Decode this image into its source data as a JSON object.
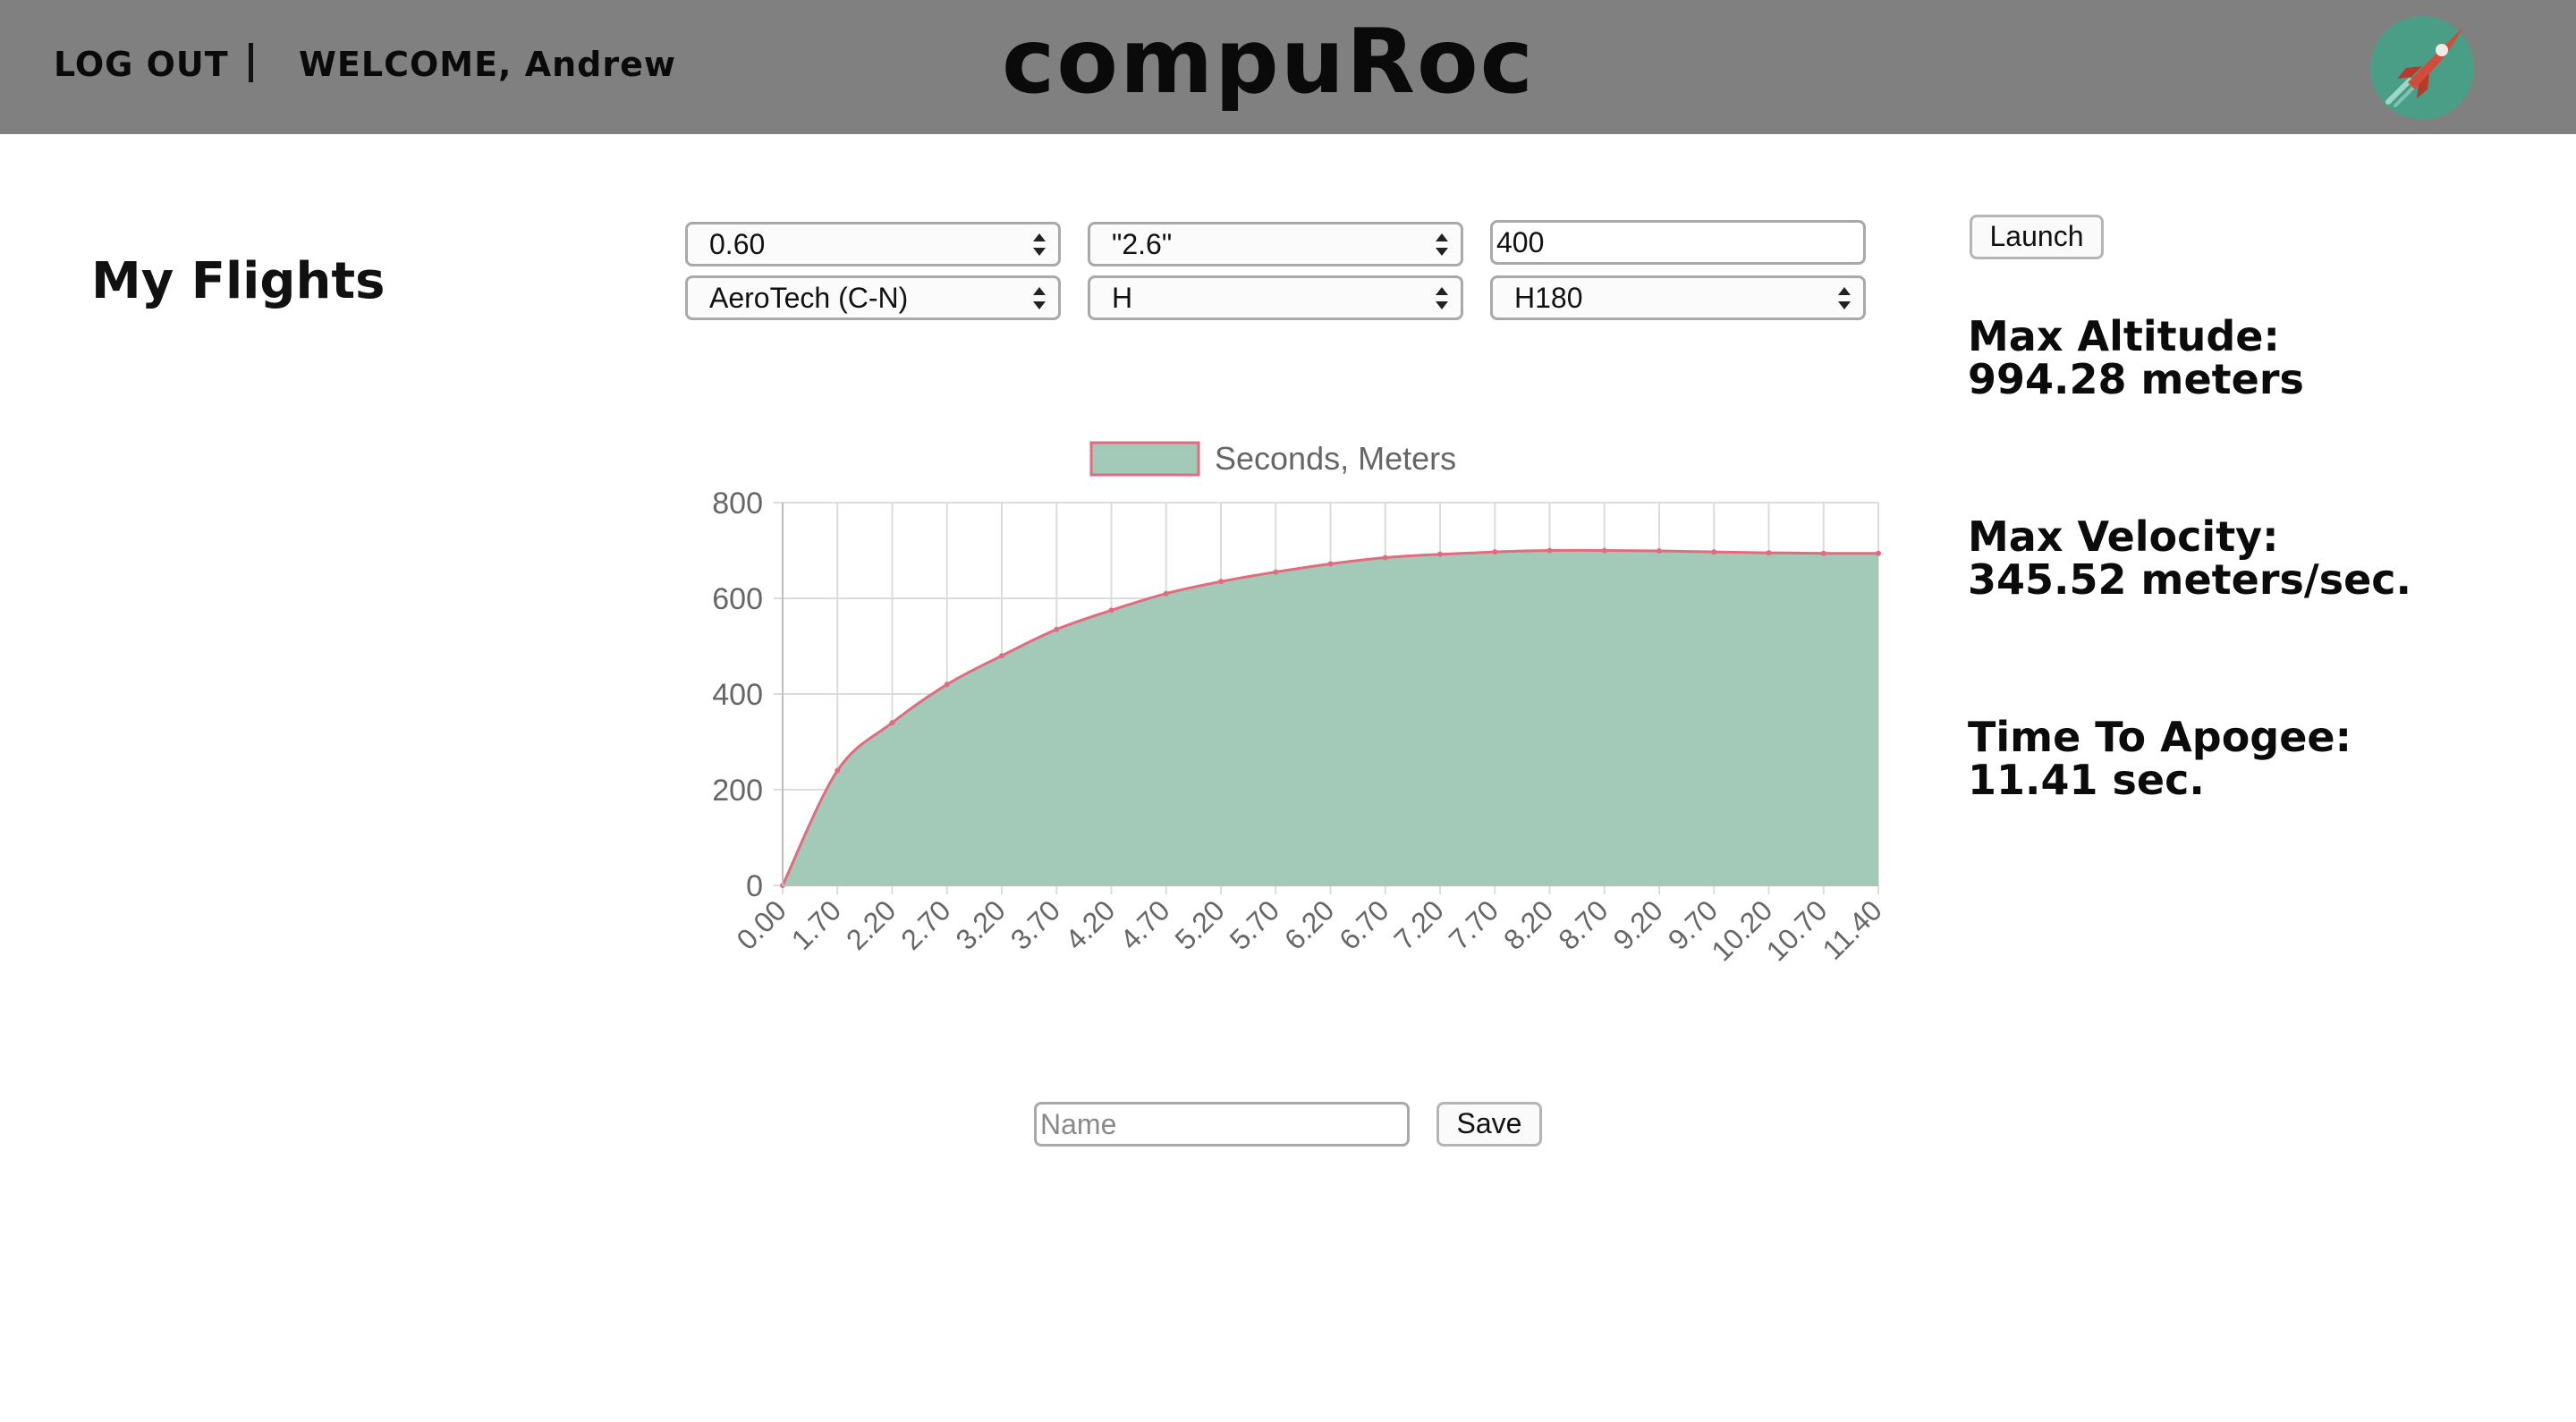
{
  "header": {
    "logout_label": "LOG OUT",
    "welcome_label": "WELCOME, Andrew",
    "app_title": "compuRoc",
    "logo_icon": "rocket-logo-icon",
    "logo_bg_color": "#4a9e86",
    "logo_rocket_color": "#d64a3b"
  },
  "sidebar": {
    "title": "My Flights"
  },
  "form": {
    "row1": {
      "select1_value": "0.60",
      "select2_value": "\"2.6\"",
      "input_value": "400"
    },
    "row2": {
      "manufacturer_value": "AeroTech (C-N)",
      "motor_class_value": "H",
      "motor_value": "H180"
    },
    "launch_label": "Launch"
  },
  "stats": {
    "max_altitude_label": "Max Altitude:",
    "max_altitude_value": "994.28 meters",
    "max_velocity_label": "Max Velocity:",
    "max_velocity_value": "345.52 meters/sec.",
    "time_to_apogee_label": "Time To Apogee:",
    "time_to_apogee_value": "11.41 sec."
  },
  "save_form": {
    "name_placeholder": "Name",
    "save_label": "Save"
  },
  "chart_data": {
    "type": "area",
    "legend": "Seconds, Meters",
    "legend_position": "top",
    "grid": true,
    "fill_color": "#a3c9b8",
    "line_color": "#e26b80",
    "ylim": [
      0,
      800
    ],
    "y_ticks": [
      "0",
      "200",
      "400",
      "600",
      "800"
    ],
    "x_tick_labels": [
      "0.00",
      "1.70",
      "2.20",
      "2.70",
      "3.20",
      "3.70",
      "4.20",
      "4.70",
      "5.20",
      "5.70",
      "6.20",
      "6.70",
      "7.20",
      "7.70",
      "8.20",
      "8.70",
      "9.20",
      "9.70",
      "10.20",
      "10.70",
      "11.40"
    ],
    "values": [
      0,
      240,
      340,
      420,
      480,
      535,
      575,
      610,
      635,
      655,
      672,
      685,
      692,
      697,
      700,
      700,
      699,
      697,
      695,
      694,
      694
    ]
  }
}
